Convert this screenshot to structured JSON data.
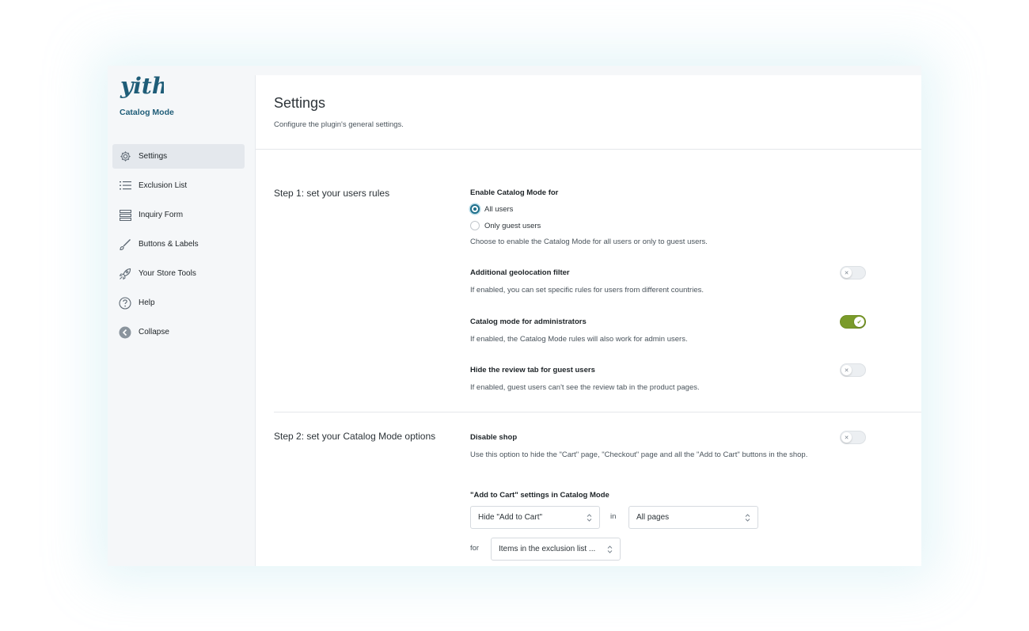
{
  "brand": {
    "logo_text": "yith",
    "product": "Catalog Mode",
    "logo_color": "#1f5d78"
  },
  "sidebar": {
    "items": [
      {
        "label": "Settings",
        "icon": "gear-icon",
        "active": true
      },
      {
        "label": "Exclusion List",
        "icon": "list-icon"
      },
      {
        "label": "Inquiry Form",
        "icon": "form-icon"
      },
      {
        "label": "Buttons & Labels",
        "icon": "brush-icon"
      },
      {
        "label": "Your Store Tools",
        "icon": "rocket-icon"
      },
      {
        "label": "Help",
        "icon": "help-icon"
      },
      {
        "label": "Collapse",
        "icon": "collapse-icon"
      }
    ]
  },
  "header": {
    "title": "Settings",
    "subtitle": "Configure the plugin's general settings."
  },
  "step1": {
    "title": "Step 1: set your users rules",
    "enable_for": {
      "label": "Enable Catalog Mode for",
      "options": [
        "All users",
        "Only guest users"
      ],
      "selected": "All users",
      "desc": "Choose to enable the Catalog Mode for all users or only to guest users."
    },
    "geolocation": {
      "label": "Additional geolocation filter",
      "desc": "If enabled, you can set specific rules for users from different countries.",
      "enabled": false
    },
    "admins": {
      "label": "Catalog mode for administrators",
      "desc": "If enabled, the Catalog Mode rules will also work for admin users.",
      "enabled": true
    },
    "review_tab": {
      "label": "Hide the review tab for guest users",
      "desc": "If enabled, guest users can't see the review tab in the product pages.",
      "enabled": false
    }
  },
  "step2": {
    "title": "Step 2: set your Catalog Mode options",
    "disable_shop": {
      "label": "Disable shop",
      "desc": "Use this option to hide the \"Cart\" page, \"Checkout\" page and all the \"Add to Cart\" buttons in the shop.",
      "enabled": false
    },
    "add_to_cart": {
      "label": "\"Add to Cart\" settings in Catalog Mode",
      "action": "Hide \"Add to Cart\"",
      "in_label": "in",
      "pages": "All pages",
      "for_label": "for",
      "target": "Items in the exclusion list ..."
    }
  },
  "colors": {
    "accent": "#1f6f8b",
    "toggle_on": "#7a9b2a"
  }
}
